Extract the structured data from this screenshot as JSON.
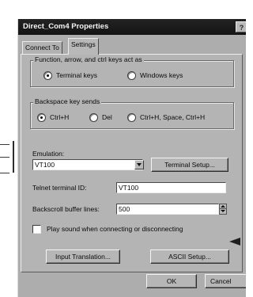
{
  "window": {
    "title": "Direct_Com4 Properties",
    "help_label": "?"
  },
  "tabs": [
    {
      "label": "Connect To",
      "active": false
    },
    {
      "label": "Settings",
      "active": true
    }
  ],
  "function_keys": {
    "legend": "Function, arrow, and ctrl keys act as",
    "options": [
      {
        "label": "Terminal keys",
        "selected": true
      },
      {
        "label": "Windows keys",
        "selected": false
      }
    ]
  },
  "backspace": {
    "legend": "Backspace key sends",
    "options": [
      {
        "label": "Ctrl+H",
        "selected": true
      },
      {
        "label": "Del",
        "selected": false
      },
      {
        "label": "Ctrl+H, Space, Ctrl+H",
        "selected": false
      }
    ]
  },
  "emulation": {
    "label": "Emulation:",
    "value": "VT100",
    "setup_button": "Terminal Setup..."
  },
  "telnet": {
    "label": "Telnet terminal ID:",
    "value": "VT100"
  },
  "backscroll": {
    "label": "Backscroll buffer lines:",
    "value": "500"
  },
  "sound": {
    "label": "Play sound when connecting or disconnecting",
    "checked": false
  },
  "buttons": {
    "input_translation": "Input Translation...",
    "ascii_setup": "ASCII Setup..."
  },
  "footer": {
    "ok": "OK",
    "cancel": "Cancel"
  }
}
